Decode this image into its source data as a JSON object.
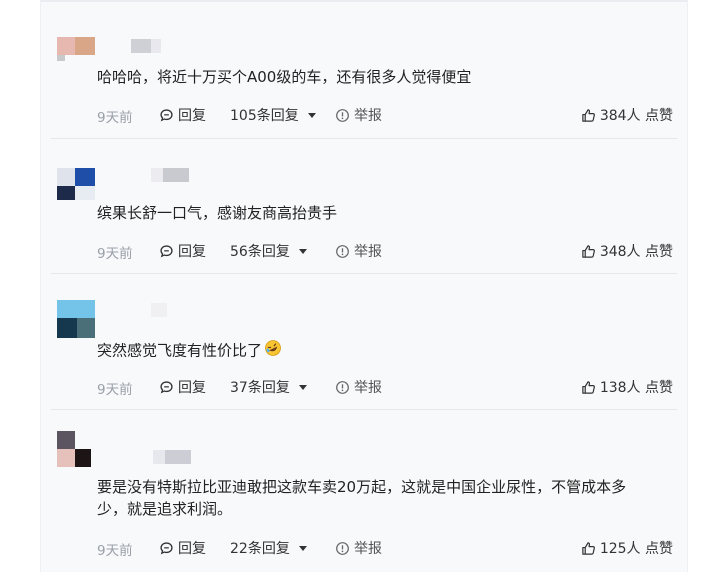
{
  "comments": [
    {
      "text": "哈哈哈，将近十万买个A00级的车，还有很多人觉得便宜",
      "time": "9天前",
      "reply_label": "回复",
      "replies_label": "105条回复",
      "report_label": "举报",
      "likes_label": "384人 点赞"
    },
    {
      "text": "缤果长舒一口气，感谢友商高抬贵手",
      "time": "9天前",
      "reply_label": "回复",
      "replies_label": "56条回复",
      "report_label": "举报",
      "likes_label": "348人 点赞"
    },
    {
      "text": "突然感觉飞度有性价比了",
      "emoji": "rofl-emoji",
      "time": "9天前",
      "reply_label": "回复",
      "replies_label": "37条回复",
      "report_label": "举报",
      "likes_label": "138人 点赞"
    },
    {
      "text_line1": "要是没有特斯拉比亚迪敢把这款车卖20万起，这就是中国企业尿性，不管成本多",
      "text_line2": "少，就是追求利润。",
      "time": "9天前",
      "reply_label": "回复",
      "replies_label": "22条回复",
      "report_label": "举报",
      "likes_label": "125人 点赞"
    }
  ],
  "icons": {
    "reply": "comment-bubble-icon",
    "dropdown": "caret-down-icon",
    "report": "warning-circle-icon",
    "like": "thumbs-up-icon"
  },
  "colors": {
    "panel_bg": "#f8f9fb",
    "muted_text": "#9aa0a8",
    "divider": "#e4e7ec"
  }
}
